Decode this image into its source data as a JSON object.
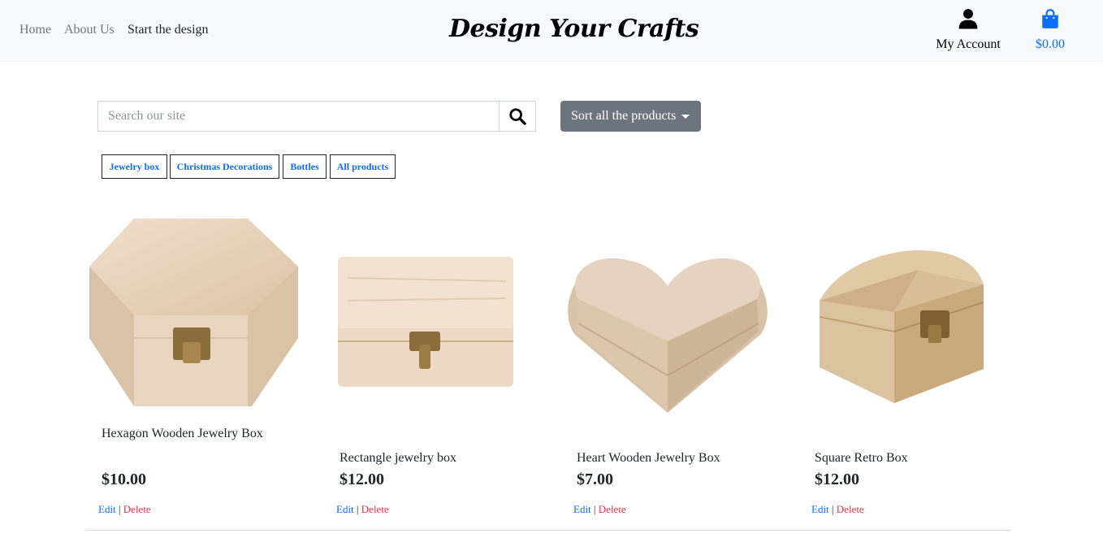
{
  "nav": {
    "links": [
      "Home",
      "About Us",
      "Start the design"
    ],
    "brand": "Design Your Crafts",
    "account_label": "My Account",
    "cart_total": "$0.00"
  },
  "search": {
    "placeholder": "Search our site",
    "value": "",
    "sort_label": "Sort all the products"
  },
  "categories": [
    "Jewelry box",
    "Christmas Decorations",
    "Bottles",
    "All products"
  ],
  "products": [
    {
      "name": "Hexagon Wooden Jewelry Box",
      "price": "$10.00",
      "edit": "Edit",
      "sep": "|",
      "delete": "Delete"
    },
    {
      "name": "Rectangle jewelry box",
      "price": "$12.00",
      "edit": "Edit",
      "sep": "|",
      "delete": "Delete"
    },
    {
      "name": "Heart Wooden Jewelry Box",
      "price": "$7.00",
      "edit": "Edit",
      "sep": "|",
      "delete": "Delete"
    },
    {
      "name": "Square Retro Box",
      "price": "$12.00",
      "edit": "Edit",
      "sep": "|",
      "delete": "Delete"
    }
  ],
  "icons": {
    "account": "person-icon",
    "cart": "shopping-bag-icon",
    "search": "search-icon",
    "sort": "caret-down-icon"
  },
  "colors": {
    "link_blue": "#0d6efd",
    "delete_red": "#dc3545",
    "navbar_bg": "#f8f9fa",
    "sort_button_bg": "#6c757d",
    "wood_light": "#ecd8c2",
    "wood_mid": "#d8bfa3"
  }
}
